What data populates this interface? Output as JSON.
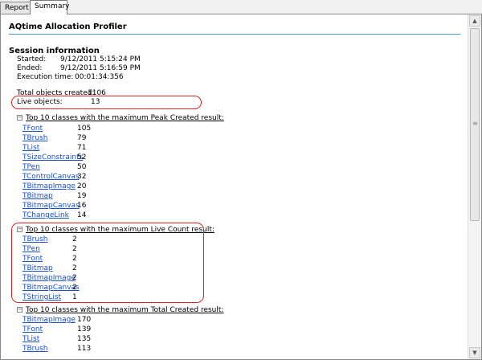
{
  "tabs": [
    {
      "label": "Report",
      "active": false
    },
    {
      "label": "Summary",
      "active": true
    }
  ],
  "report": {
    "title": "AQtime Allocation Profiler",
    "session": {
      "heading": "Session information",
      "started_label": "Started:",
      "started_value": "9/12/2011 5:15:24 PM",
      "ended_label": "Ended:",
      "ended_value": "9/12/2011 5:16:59 PM",
      "execution_label": "Execution time:",
      "execution_value": "00:01:34:356"
    },
    "totals": {
      "total_label": "Total objects created:",
      "total_value": "1106",
      "live_label": "Live objects:",
      "live_value": "13"
    },
    "groups": [
      {
        "title": "Top 10 classes with the maximum Peak Created result:",
        "toggle": "⊟",
        "rows": [
          {
            "name": "TFont",
            "value": "105"
          },
          {
            "name": "TBrush",
            "value": "79"
          },
          {
            "name": "TList",
            "value": "71"
          },
          {
            "name": "TSizeConstraints",
            "value": "52"
          },
          {
            "name": "TPen",
            "value": "50"
          },
          {
            "name": "TControlCanvas",
            "value": "32"
          },
          {
            "name": "TBitmapImage",
            "value": "20"
          },
          {
            "name": "TBitmap",
            "value": "19"
          },
          {
            "name": "TBitmapCanvas",
            "value": "16"
          },
          {
            "name": "TChangeLink",
            "value": "14"
          }
        ]
      },
      {
        "title": "Top 10 classes with the maximum Live Count result:",
        "toggle": "⊟",
        "rows": [
          {
            "name": "TBrush",
            "value": "2"
          },
          {
            "name": "TPen",
            "value": "2"
          },
          {
            "name": "TFont",
            "value": "2"
          },
          {
            "name": "TBitmap",
            "value": "2"
          },
          {
            "name": "TBitmapImage",
            "value": "2"
          },
          {
            "name": "TBitmapCanvas",
            "value": "2"
          },
          {
            "name": "TStringList",
            "value": "1"
          }
        ]
      },
      {
        "title": "Top 10 classes with the maximum Total Created result:",
        "toggle": "⊟",
        "rows": [
          {
            "name": "TBitmapImage",
            "value": "170"
          },
          {
            "name": "TFont",
            "value": "139"
          },
          {
            "name": "TList",
            "value": "135"
          },
          {
            "name": "TBrush",
            "value": "113"
          }
        ]
      }
    ]
  },
  "colors": {
    "link": "#1a4fd0",
    "highlight": "#d9252a",
    "title_rule": "#4a9ad8"
  },
  "icons": {
    "collapse_toggle": "minus-box-icon",
    "scroll_up": "arrow-up-icon",
    "scroll_down": "arrow-down-icon",
    "scroll_grip": "grip-icon"
  }
}
